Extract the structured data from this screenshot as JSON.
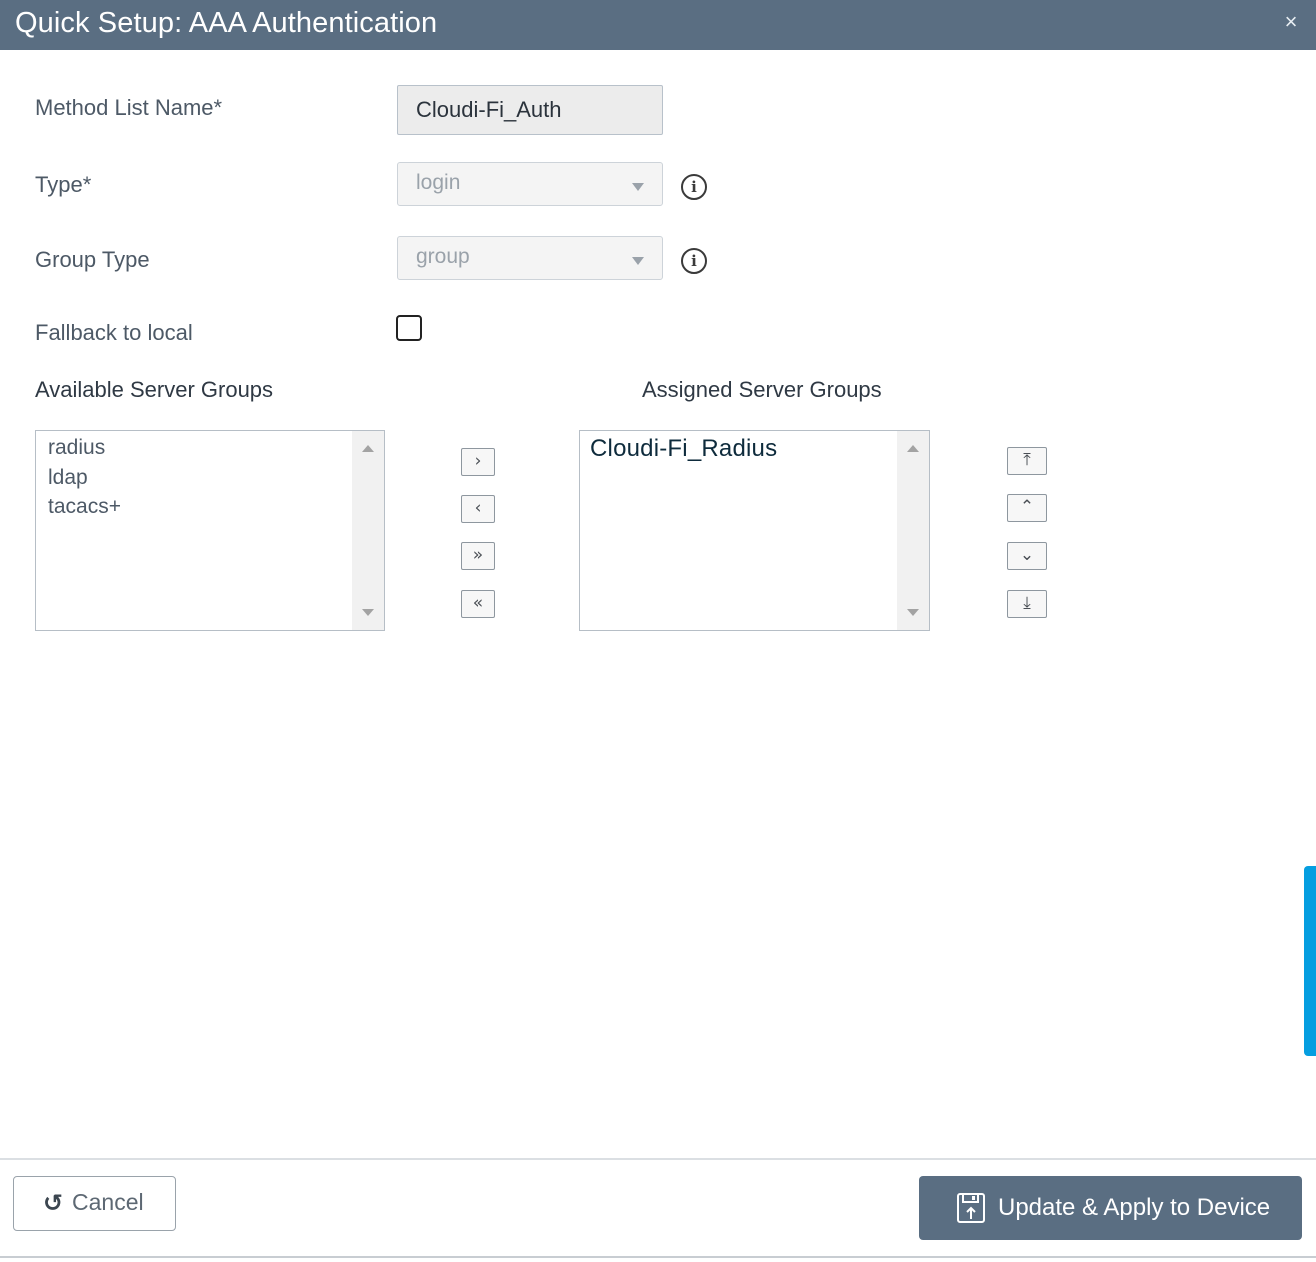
{
  "dialog": {
    "title": "Quick Setup: AAA Authentication",
    "close_icon": "×"
  },
  "form": {
    "method_list_name": {
      "label": "Method List Name*",
      "value": "Cloudi-Fi_Auth"
    },
    "type": {
      "label": "Type*",
      "selected": "login"
    },
    "group_type": {
      "label": "Group Type",
      "selected": "group"
    },
    "fallback": {
      "label": "Fallback to local",
      "checked": false
    },
    "info_icon": "i"
  },
  "available": {
    "title": "Available Server Groups",
    "items": [
      "radius",
      "ldap",
      "tacacs+"
    ]
  },
  "assigned": {
    "title": "Assigned Server Groups",
    "items": [
      "Cloudi-Fi_Radius"
    ]
  },
  "transfer_buttons": {
    "move_right": "›",
    "move_left": "‹",
    "move_all_right": "»",
    "move_all_left": "«"
  },
  "order_buttons": {
    "move_top": "⤒",
    "move_up": "⌃",
    "move_down": "⌄",
    "move_bottom": "⤓"
  },
  "footer": {
    "cancel_label": "Cancel",
    "cancel_icon": "↺",
    "apply_label": "Update & Apply to Device"
  },
  "colors": {
    "header": "#5a6e82",
    "accent_tab": "#059ee0",
    "primary_button": "#5a6e82"
  }
}
